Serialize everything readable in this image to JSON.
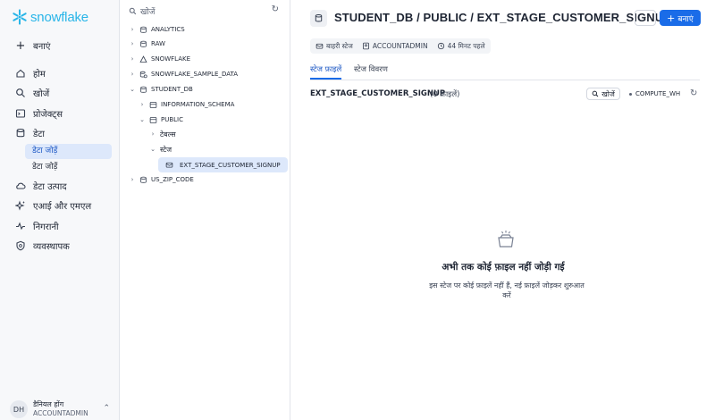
{
  "nav": {
    "logo_text": "snowflake",
    "create": "बनाएं",
    "home": "होम",
    "search": "खोजें",
    "projects": "प्रोजेक्ट्स",
    "data": "डेटा",
    "data_sub_active": "डेटा जोड़ें",
    "data_sub": "डेटा जोड़ें",
    "data_products": "डेटा उत्पाद",
    "ai_ml": "एआई और एमएल",
    "monitoring": "निगरानी",
    "admin": "व्यवस्थापक",
    "user_initials": "DH",
    "user_name": "डैनियल होंग",
    "user_role": "ACCOUNTADMIN"
  },
  "explorer": {
    "search_placeholder": "खोजें",
    "items": [
      {
        "label": "ANALYTICS"
      },
      {
        "label": "RAW"
      },
      {
        "label": "SNOWFLAKE"
      },
      {
        "label": "SNOWFLAKE_SAMPLE_DATA"
      },
      {
        "label": "STUDENT_DB"
      },
      {
        "label": "INFORMATION_SCHEMA"
      },
      {
        "label": "PUBLIC"
      },
      {
        "label": "टेबल्स"
      },
      {
        "label": "स्टेज"
      },
      {
        "label": "EXT_STAGE_CUSTOMER_SIGNUP"
      },
      {
        "label": "US_ZIP_CODE"
      }
    ]
  },
  "main": {
    "title": "STUDENT_DB / PUBLIC / EXT_STAGE_CUSTOMER_SIGNUP",
    "more": "···",
    "create_label": "बनाएं",
    "meta": {
      "stage_type": "बाहरी स्टेज",
      "owner": "ACCOUNTADMIN",
      "time": "44 मिनट पहले"
    },
    "tabs": [
      "स्टेज फ़ाइलें",
      "स्टेज विवरण"
    ],
    "stage_name": "EXT_STAGE_CUSTOMER_SIGNUP",
    "file_count": "(0 फ़ाइलें)",
    "search_label": "खोजें",
    "warehouse": "COMPUTE_WH",
    "empty_title": "अभी तक कोई फ़ाइल नहीं जोड़ी गई",
    "empty_desc": "इस स्टेज पर कोई फ़ाइलें नहीं हैं, नई फ़ाइलें जोड़कर शुरुआत करें"
  },
  "colors": {
    "accent": "#1a6ce8",
    "logo": "#29b5e8",
    "selected_bg": "#dde8fb"
  }
}
